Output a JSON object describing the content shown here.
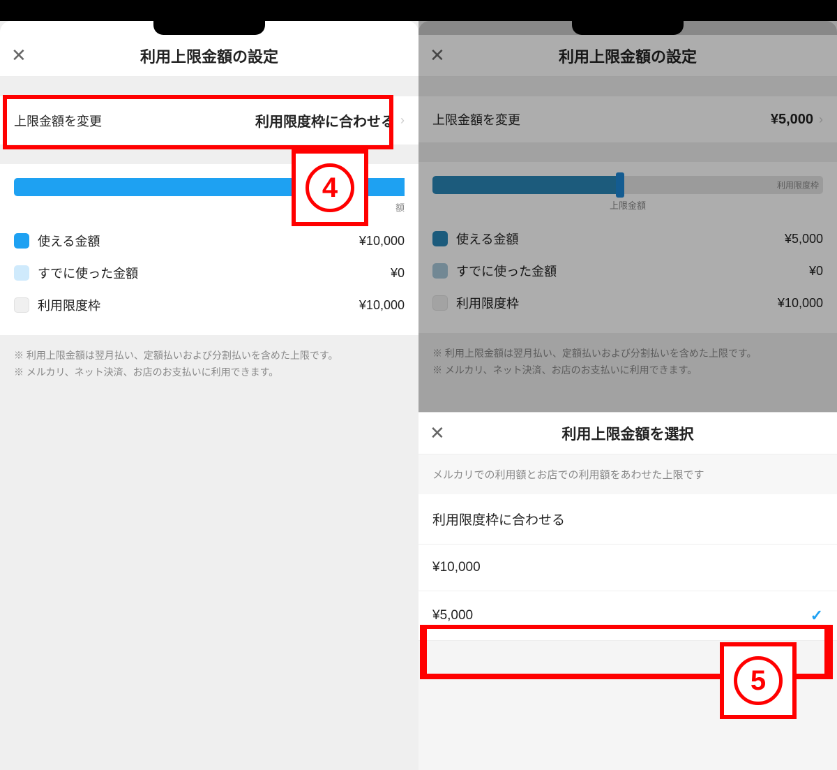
{
  "left": {
    "header_title": "利用上限金額の設定",
    "change_row_label": "上限金額を変更",
    "change_row_value": "利用限度枠に合わせる",
    "slider_end_label": "額",
    "legend": {
      "available_label": "使える金額",
      "available_value": "¥10,000",
      "used_label": "すでに使った金額",
      "used_value": "¥0",
      "limit_label": "利用限度枠",
      "limit_value": "¥10,000"
    },
    "disclaimer1": "※ 利用上限金額は翌月払い、定額払いおよび分割払いを含めた上限です。",
    "disclaimer2": "※ メルカリ、ネット決済、お店のお支払いに利用できます。",
    "annotation_number": "4"
  },
  "right": {
    "header_title": "利用上限金額の設定",
    "change_row_label": "上限金額を変更",
    "change_row_value": "¥5,000",
    "slider_caption": "上限金額",
    "slider_end_label": "利用限度枠",
    "legend": {
      "available_label": "使える金額",
      "available_value": "¥5,000",
      "used_label": "すでに使った金額",
      "used_value": "¥0",
      "limit_label": "利用限度枠",
      "limit_value": "¥10,000"
    },
    "disclaimer1": "※ 利用上限金額は翌月払い、定額払いおよび分割払いを含めた上限です。",
    "disclaimer2": "※ メルカリ、ネット決済、お店のお支払いに利用できます。",
    "sheet": {
      "title": "利用上限金額を選択",
      "desc": "メルカリでの利用額とお店での利用額をあわせた上限です",
      "option1": "利用限度枠に合わせる",
      "option2": "¥10,000",
      "option3": "¥5,000"
    },
    "annotation_number": "5"
  }
}
